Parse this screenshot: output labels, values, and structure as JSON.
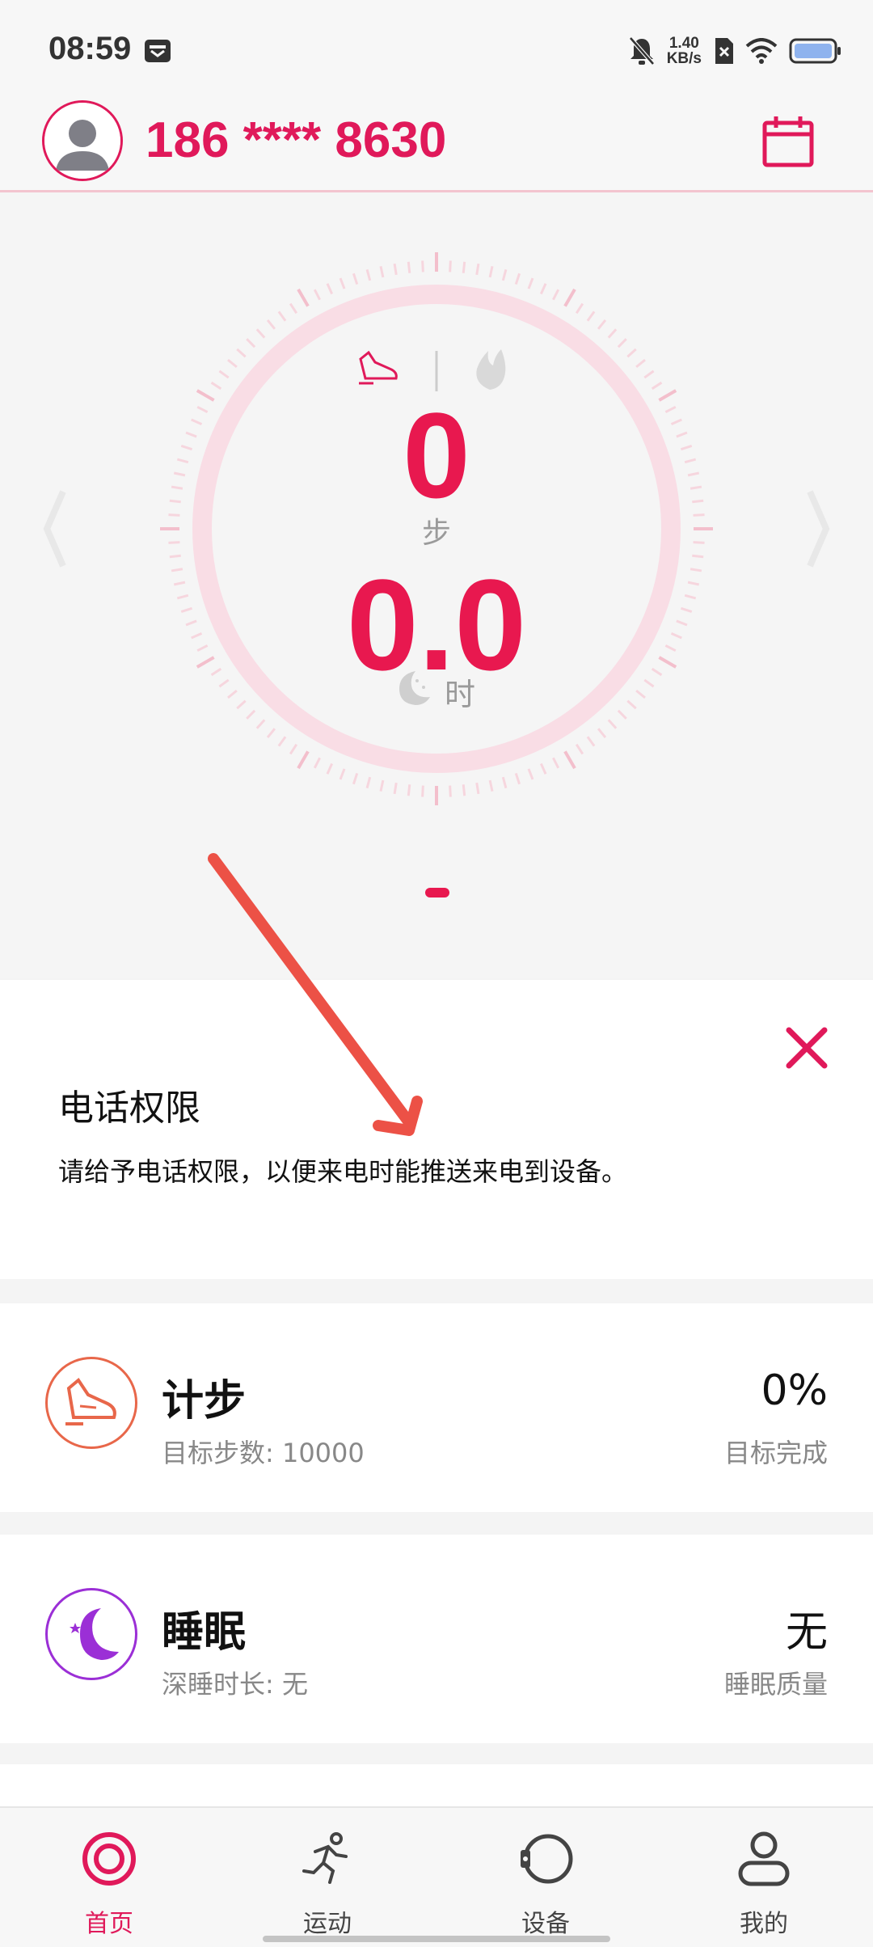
{
  "status_bar": {
    "time": "08:59",
    "net_speed_value": "1.40",
    "net_speed_unit": "KB/s"
  },
  "header": {
    "phone_number": "186 **** 8630"
  },
  "dashboard": {
    "steps_value": "0",
    "steps_unit": "步",
    "sleep_value": "0.0",
    "sleep_unit": "时"
  },
  "permission_card": {
    "title": "电话权限",
    "description": "请给予电话权限，以便来电时能推送来电到设备。"
  },
  "steps_card": {
    "title": "计步",
    "subtitle": "目标步数:  10000",
    "value": "0%",
    "label": "目标完成"
  },
  "sleep_card": {
    "title": "睡眠",
    "subtitle": "深睡时长:  无",
    "value": "无",
    "label": "睡眠质量"
  },
  "bottom_nav": {
    "items": [
      {
        "label": "首页",
        "icon": "target-icon",
        "active": true
      },
      {
        "label": "运动",
        "icon": "runner-icon",
        "active": false
      },
      {
        "label": "设备",
        "icon": "watch-icon",
        "active": false
      },
      {
        "label": "我的",
        "icon": "user-icon",
        "active": false
      }
    ]
  },
  "colors": {
    "accent": "#e0195a",
    "ring": "#f9dde5",
    "steps_icon": "#e8674a",
    "sleep_icon": "#9b2fd6"
  }
}
